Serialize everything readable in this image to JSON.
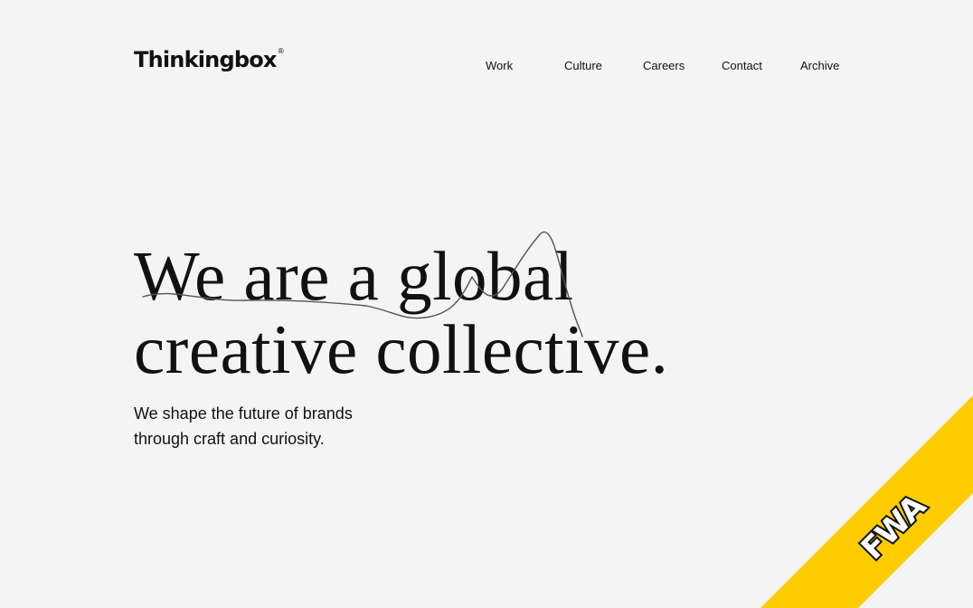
{
  "header": {
    "logo_text": "Thinkingbox",
    "logo_mark": "®"
  },
  "nav": {
    "items": [
      {
        "label": "Work"
      },
      {
        "label": "Culture"
      },
      {
        "label": "Careers"
      },
      {
        "label": "Contact"
      },
      {
        "label": "Archive"
      }
    ]
  },
  "hero": {
    "headline_line1": "We are a global",
    "headline_line2": "creative collective.",
    "subtext_line1": "We shape the future of brands",
    "subtext_line2": "through craft and curiosity."
  },
  "badge": {
    "text": "FWA",
    "color": "#ffcc00"
  },
  "colors": {
    "background": "#f4f4f4",
    "text": "#111111",
    "scribble": "#555555"
  }
}
